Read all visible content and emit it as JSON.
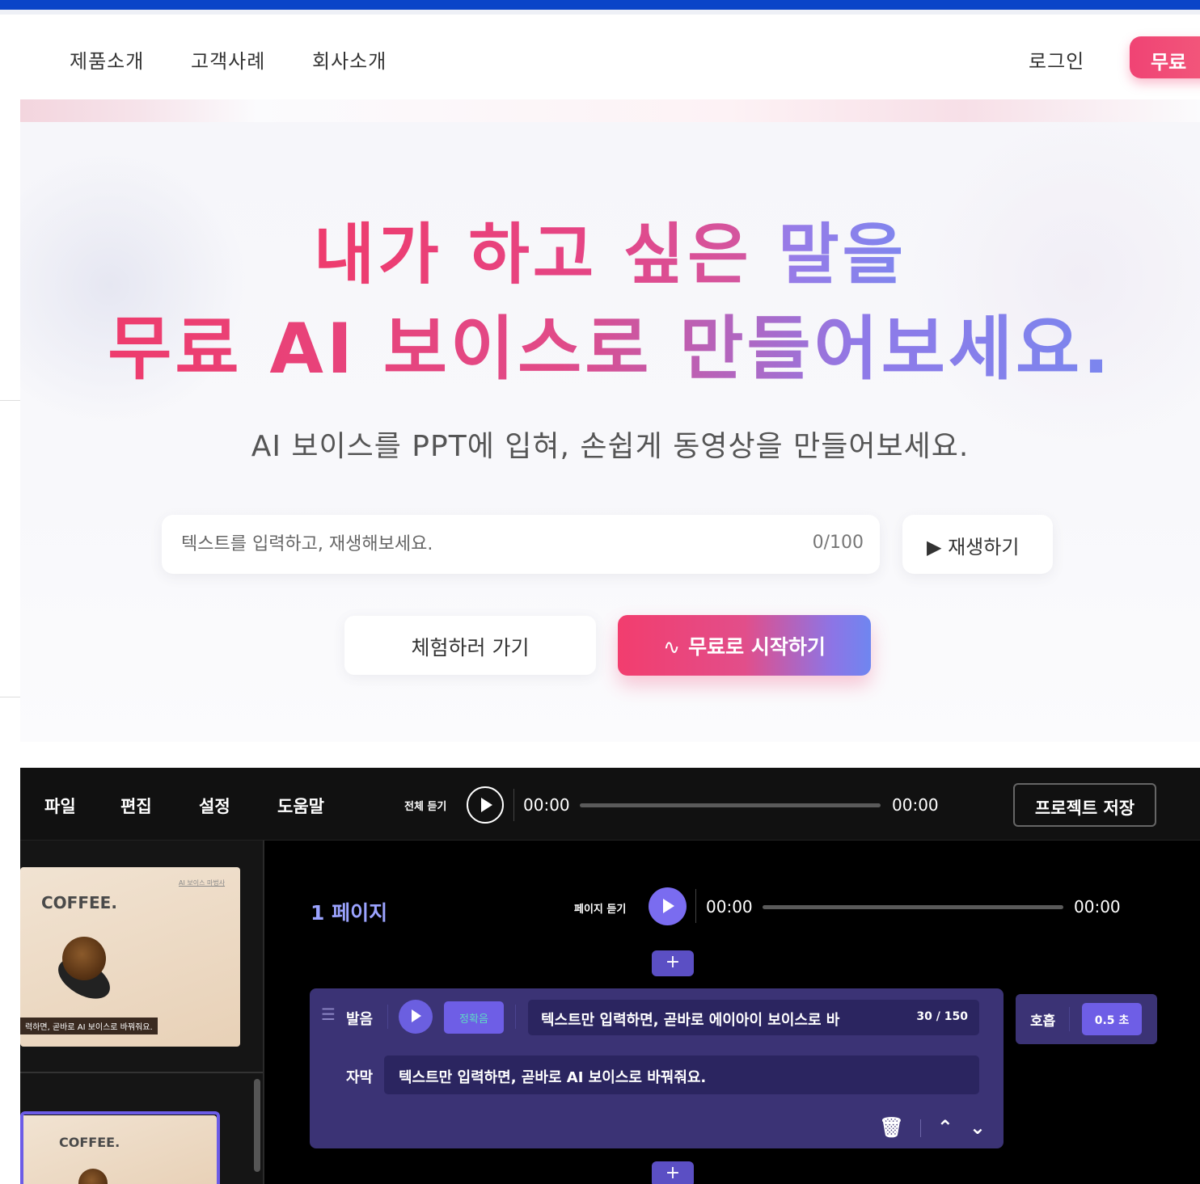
{
  "nav": {
    "items": [
      "제품소개",
      "고객사례",
      "회사소개"
    ],
    "login": "로그인",
    "cta": "무료"
  },
  "hero": {
    "title_line1_a": "내가 하고 싶은 ",
    "title_line1_b": "말을",
    "title_line2": "무료 AI 보이스로 만들어보세요.",
    "subtitle": "AI 보이스를 PPT에 입혀, 손쉽게 동영상을 만들어보세요.",
    "input_placeholder": "텍스트를 입력하고, 재생해보세요.",
    "char_count": "0/100",
    "play_label": "▶ 재생하기",
    "try_label": "체험하러 가기",
    "start_icon": "∿",
    "start_label": "무료로 시작하기"
  },
  "editor": {
    "menu": [
      "파일",
      "편집",
      "설정",
      "도움말"
    ],
    "listen_all": "전체 듣기",
    "time_start": "00:00",
    "time_end": "00:00",
    "save_label": "프로젝트 저장",
    "slides": [
      {
        "title": "COFFEE.",
        "caption": "력하면, 곧바로 AI 보이스로 바꿔줘요.",
        "mini": "AI 보이스 마법사"
      },
      {
        "title": "COFFEE."
      }
    ],
    "page": {
      "title": "1 페이지",
      "listen": "페이지 듣기",
      "time_start": "00:00",
      "time_end": "00:00"
    },
    "card": {
      "pron_label": "발음",
      "tag": "정확음",
      "pron_text": "텍스트만 입력하면, 곧바로 에이아이 보이스로 바",
      "pron_count": "30 / 150",
      "sub_label": "자막",
      "sub_text": "텍스트만 입력하면, 곧바로 AI 보이스로 바꿔줘요.",
      "trash_icon": "🗑",
      "up_icon": "⌃",
      "down_icon": "⌄"
    },
    "breath": {
      "label": "호흡",
      "value": "0.5 초"
    },
    "plus": "+"
  },
  "colors": {
    "accent_pink": "#f04374",
    "accent_purple": "#6c5ce7",
    "top_bar": "#0a44c8"
  }
}
